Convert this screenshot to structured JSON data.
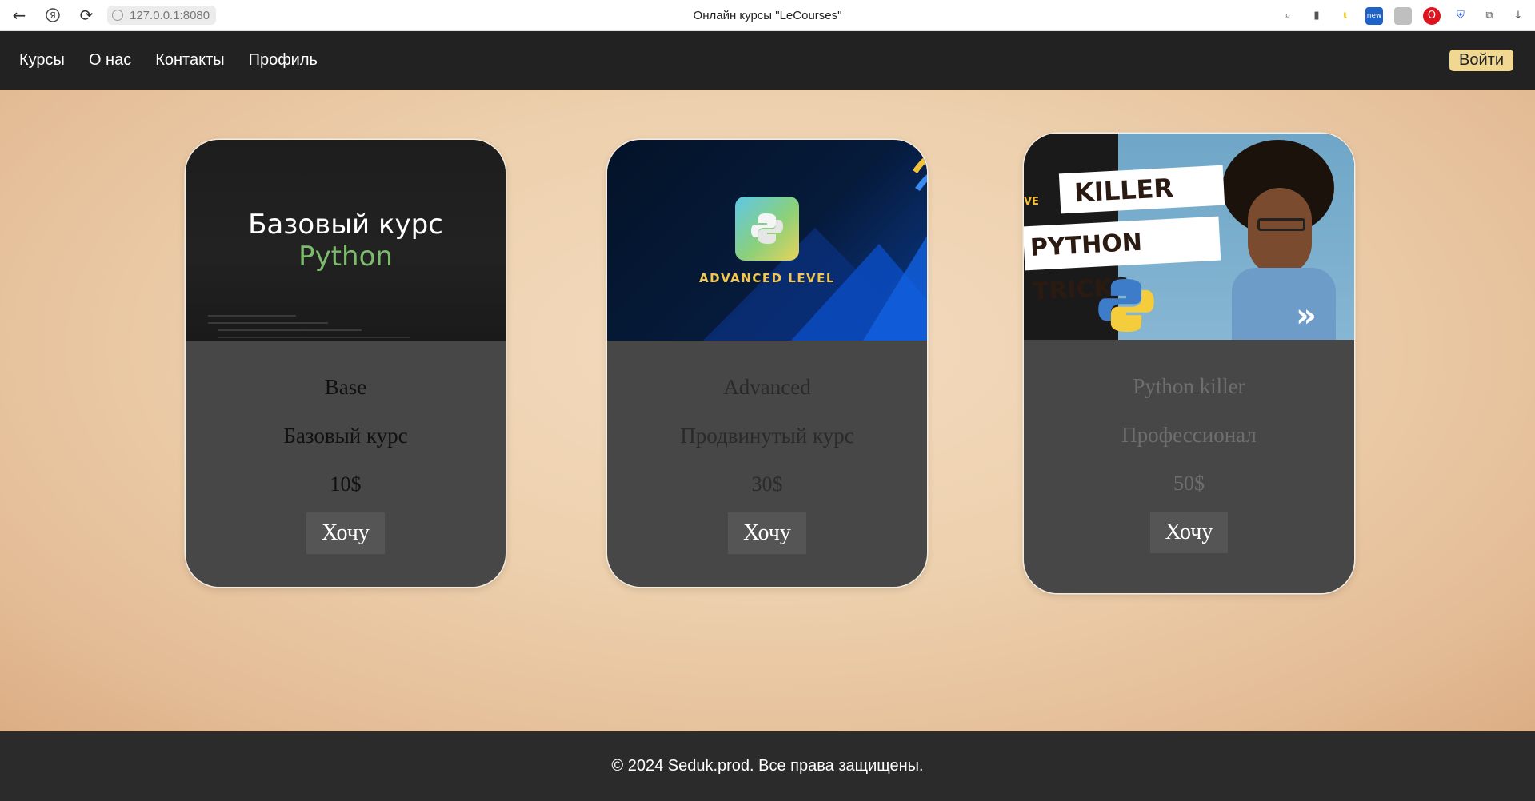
{
  "browser": {
    "url": "127.0.0.1:8080",
    "tab_title": "Онлайн курсы \"LeCourses\""
  },
  "nav": {
    "items": [
      "Курсы",
      "О нас",
      "Контакты",
      "Профиль"
    ],
    "login_label": "Войти"
  },
  "courses": [
    {
      "image_title": "Базовый курс",
      "image_subtitle": "Python",
      "title": "Base",
      "description": "Базовый курс",
      "price": "10$",
      "button": "Хочу",
      "text_color": "#111111"
    },
    {
      "image_label": "ADVANCED LEVEL",
      "title": "Advanced",
      "description": "Продвинутый курс",
      "price": "30$",
      "button": "Хочу",
      "text_color": "#2a2a2a"
    },
    {
      "image_line1": "KILLER",
      "image_line2": "PYTHON TRICKS",
      "image_tag": "VE",
      "title": "Python killer",
      "description": "Профессионал",
      "price": "50$",
      "button": "Хочу",
      "text_color": "#6e6e6e"
    }
  ],
  "footer": {
    "text": "© 2024 Seduk.prod. Все права защищены."
  }
}
